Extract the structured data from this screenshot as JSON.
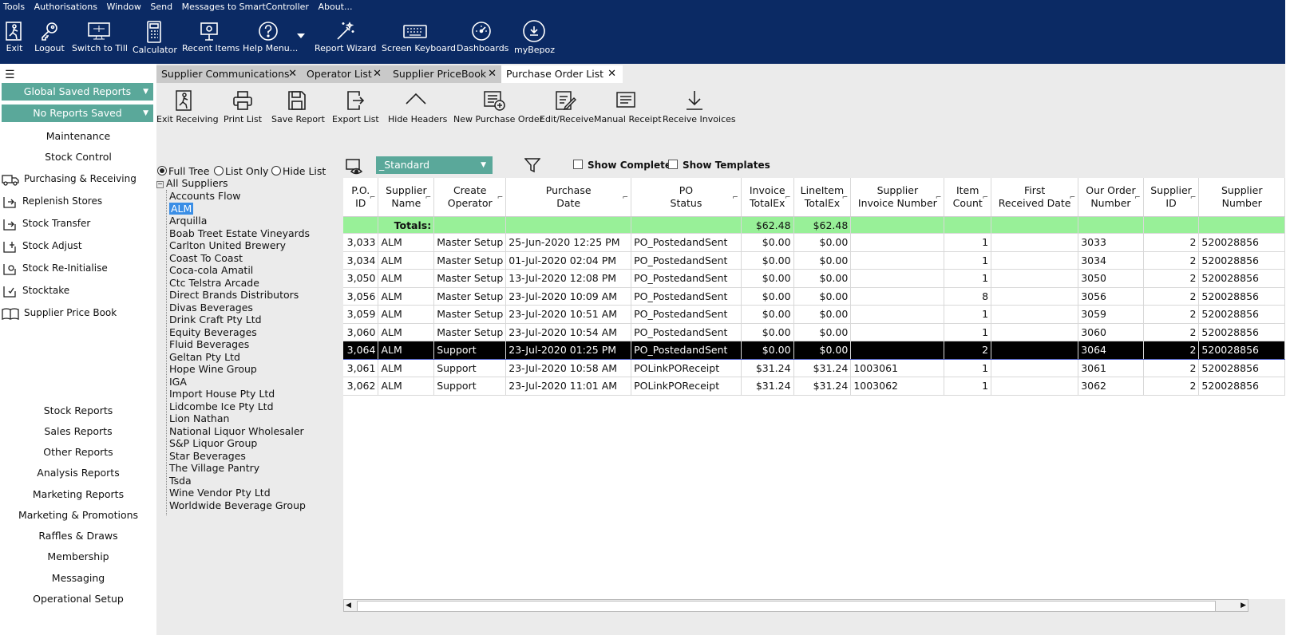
{
  "menu": [
    "Tools",
    "Authorisations",
    "Window",
    "Send",
    "Messages to SmartController",
    "About..."
  ],
  "toolbar": [
    {
      "label": "Exit",
      "icon": "exit-icon"
    },
    {
      "label": "Logout",
      "icon": "key-icon"
    },
    {
      "label": "Switch to Till",
      "icon": "till-icon"
    },
    {
      "label": "Calculator",
      "icon": "calculator-icon"
    },
    {
      "label": "Recent Items",
      "icon": "recent-items-icon"
    },
    {
      "label": "Help Menu...",
      "icon": "help-icon"
    },
    {
      "label": "Report Wizard",
      "icon": "wand-icon"
    },
    {
      "label": "Screen Keyboard",
      "icon": "keyboard-icon"
    },
    {
      "label": "Dashboards",
      "icon": "dashboard-icon"
    },
    {
      "label": "myBepoz",
      "icon": "mybepoz-icon"
    }
  ],
  "sidebar": {
    "global_reports": "Global Saved Reports",
    "no_reports": "No Reports Saved",
    "maintenance": "Maintenance",
    "stock_control": "Stock Control",
    "items": [
      "Purchasing & Receiving",
      "Replenish Stores",
      "Stock Transfer",
      "Stock Adjust",
      "Stock Re-Initialise",
      "Stocktake",
      "Supplier Price Book"
    ],
    "bottom": [
      "Stock Reports",
      "Sales Reports",
      "Other Reports",
      "Analysis Reports",
      "Marketing Reports",
      "Marketing & Promotions",
      "Raffles & Draws",
      "Membership",
      "Messaging",
      "Operational Setup"
    ]
  },
  "tabs": [
    "Supplier Communications",
    "Operator List",
    "Supplier PriceBook",
    "Purchase Order List"
  ],
  "actions": [
    "Exit Receiving",
    "Print List",
    "Save Report",
    "Export List",
    "Hide Headers",
    "New Purchase Order",
    "Edit/Receive",
    "Manual Receipt",
    "Receive Invoices"
  ],
  "view": {
    "full_tree": "Full Tree",
    "list_only": "List Only",
    "hide_list": "Hide List",
    "layout": "_Standard",
    "show_completed": "Show Completed",
    "show_templates": "Show Templates"
  },
  "tree": {
    "root": "All Suppliers",
    "selected": "ALM",
    "items": [
      "Accounts Flow",
      "ALM",
      "Arquilla",
      "Boab Treet Estate Vineyards",
      "Carlton United Brewery",
      "Coast To Coast",
      "Coca-cola Amatil",
      "Ctc Telstra Arcade",
      "Direct Brands Distributors",
      "Divas Beverages",
      "Drink Craft Pty Ltd",
      "Equity Beverages",
      "Fluid Beverages",
      "Geltan Pty Ltd",
      "Hope Wine Group",
      "IGA",
      "Import House Pty Ltd",
      "Lidcombe Ice Pty Ltd",
      "Lion Nathan",
      "National Liquor Wholesaler",
      "S&P Liquor Group",
      "Star Beverages",
      "The Village Pantry",
      "Tsda",
      "Wine Vendor Pty Ltd",
      "Worldwide Beverage Group"
    ]
  },
  "grid": {
    "columns": [
      {
        "l1": "P.O.",
        "l2": "ID"
      },
      {
        "l1": "Supplier",
        "l2": "Name"
      },
      {
        "l1": "Create",
        "l2": "Operator"
      },
      {
        "l1": "Purchase",
        "l2": "Date"
      },
      {
        "l1": "PO",
        "l2": "Status"
      },
      {
        "l1": "Invoice",
        "l2": "TotalEx"
      },
      {
        "l1": "LineItem",
        "l2": "TotalEx"
      },
      {
        "l1": "Supplier",
        "l2": "Invoice Number"
      },
      {
        "l1": "Item",
        "l2": "Count"
      },
      {
        "l1": "First",
        "l2": "Received Date"
      },
      {
        "l1": "Our Order",
        "l2": "Number"
      },
      {
        "l1": "Supplier",
        "l2": "ID"
      },
      {
        "l1": "Supplier",
        "l2": "Number"
      }
    ],
    "totals": {
      "label": "Totals:",
      "invoice": "$62.48",
      "lineitem": "$62.48"
    },
    "selected_index": 6,
    "rows": [
      [
        "3,033",
        "ALM",
        "Master Setup",
        "25-Jun-2020 12:25 PM",
        "PO_PostedandSent",
        "$0.00",
        "$0.00",
        "",
        "1",
        "",
        "3033",
        "2",
        "520028856"
      ],
      [
        "3,034",
        "ALM",
        "Master Setup",
        "01-Jul-2020 02:04 PM",
        "PO_PostedandSent",
        "$0.00",
        "$0.00",
        "",
        "1",
        "",
        "3034",
        "2",
        "520028856"
      ],
      [
        "3,050",
        "ALM",
        "Master Setup",
        "13-Jul-2020 12:08 PM",
        "PO_PostedandSent",
        "$0.00",
        "$0.00",
        "",
        "1",
        "",
        "3050",
        "2",
        "520028856"
      ],
      [
        "3,056",
        "ALM",
        "Master Setup",
        "23-Jul-2020 10:09 AM",
        "PO_PostedandSent",
        "$0.00",
        "$0.00",
        "",
        "8",
        "",
        "3056",
        "2",
        "520028856"
      ],
      [
        "3,059",
        "ALM",
        "Master Setup",
        "23-Jul-2020 10:51 AM",
        "PO_PostedandSent",
        "$0.00",
        "$0.00",
        "",
        "1",
        "",
        "3059",
        "2",
        "520028856"
      ],
      [
        "3,060",
        "ALM",
        "Master Setup",
        "23-Jul-2020 10:54 AM",
        "PO_PostedandSent",
        "$0.00",
        "$0.00",
        "",
        "1",
        "",
        "3060",
        "2",
        "520028856"
      ],
      [
        "3,064",
        "ALM",
        "Support",
        "23-Jul-2020 01:25 PM",
        "PO_PostedandSent",
        "$0.00",
        "$0.00",
        "",
        "2",
        "",
        "3064",
        "2",
        "520028856"
      ],
      [
        "3,061",
        "ALM",
        "Support",
        "23-Jul-2020 10:58 AM",
        "POLinkPOReceipt",
        "$31.24",
        "$31.24",
        "1003061",
        "1",
        "",
        "3061",
        "2",
        "520028856"
      ],
      [
        "3,062",
        "ALM",
        "Support",
        "23-Jul-2020 11:01 AM",
        "POLinkPOReceipt",
        "$31.24",
        "$31.24",
        "1003062",
        "1",
        "",
        "3062",
        "2",
        "520028856"
      ]
    ]
  }
}
